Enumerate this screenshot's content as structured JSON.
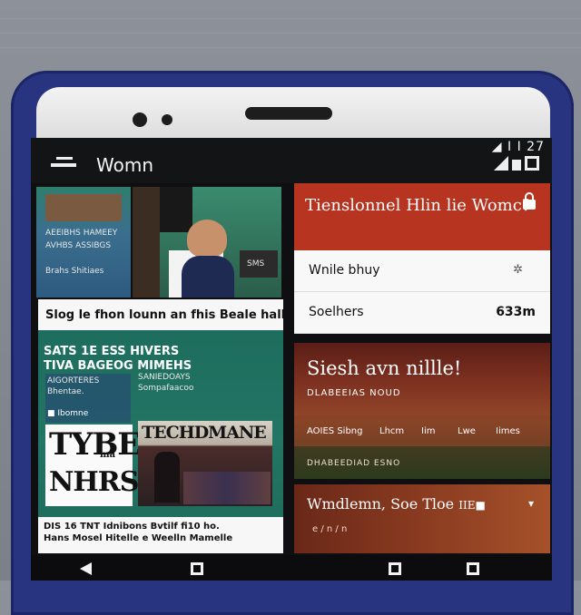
{
  "app": {
    "title": "Womn",
    "status_right": "◢ I I 27"
  },
  "left": {
    "headline": "Slog le fhon lounn an fhis Beale hally",
    "green_title": "SATS 1E ESS HIVERS\nTIVA BAGEOG MIMEHS",
    "poster_big_1": "TYBE",
    "poster_small": "ma",
    "poster_big_2": "NHRS",
    "poster_dark_title": "TECHDMANE",
    "caption_line_1": "DIS 16 TNT Idnibons Bvtilf     fi10 ho.",
    "caption_line_2": "Hans Mosel Hitelle e Weelln Mamelle"
  },
  "right": {
    "header_title": "Tienslonnel Hlin lie Womc?",
    "rows": [
      {
        "label": "Wnile bhuy",
        "value": "",
        "icon": "✲"
      },
      {
        "label": "Soelhers",
        "value": "633m",
        "icon": ""
      }
    ],
    "dusk_title": "Siesh avn nillle!",
    "dusk_sub": "DLABEEIAS NOUD",
    "dusk_items": [
      "AOIES Sibng",
      "Lhcm",
      "Iim",
      "Lwe",
      "Iimes"
    ],
    "dusk_foot": "DHABEEDIAD ESNO",
    "weather_title": "Wmdlemn, Soe Tloe",
    "weather_badge": "IIE■",
    "weather_sub": "e / n / n"
  }
}
